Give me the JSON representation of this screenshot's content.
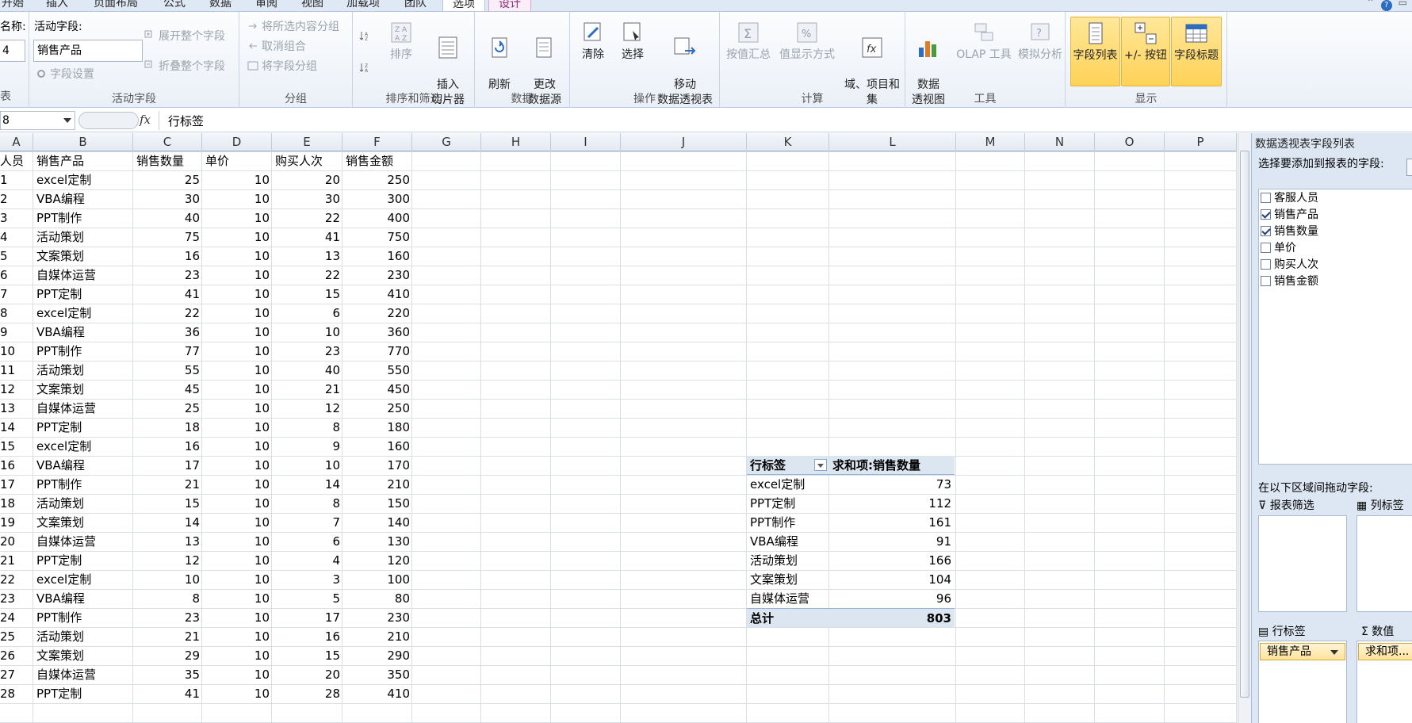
{
  "tabs": [
    "开始",
    "插入",
    "页面布局",
    "公式",
    "数据",
    "审阅",
    "视图",
    "加载项",
    "团队",
    "选项",
    "设计"
  ],
  "ribbon": {
    "pivot_name_label": "名称:",
    "pivot_name_value": "4",
    "active_field_label": "活动字段:",
    "active_field_value": "销售产品",
    "field_settings": "字段设置",
    "expand_field": "展开整个字段",
    "collapse_field": "折叠整个字段",
    "group_active": "活动字段",
    "group_selection": "将所选内容分组",
    "ungroup": "取消组合",
    "group_field": "将字段分组",
    "group_group": "分组",
    "sort": "排序",
    "insert_slicer": "插入\n切片器",
    "group_sortfilter": "排序和筛选",
    "refresh": "刷新",
    "change_source": "更改\n数据源",
    "group_data": "数据",
    "clear": "清除",
    "select": "选择",
    "move_pivot": "移动\n数据透视表",
    "group_actions": "操作",
    "summarize": "按值汇总",
    "show_values": "值显示方式",
    "fields_items": "域、项目和\n集",
    "group_calc": "计算",
    "pivot_chart": "数据\n透视图",
    "olap": "OLAP 工具",
    "whatif": "模拟分析",
    "group_tools": "工具",
    "field_list": "字段列表",
    "buttons": "+/- 按钮",
    "field_headers": "字段标题",
    "group_show": "显示",
    "table_label": "表"
  },
  "formula_bar": {
    "name_box": "8",
    "value": "行标签"
  },
  "columns": [
    "A",
    "B",
    "C",
    "D",
    "E",
    "F",
    "G",
    "H",
    "I",
    "J",
    "K",
    "L",
    "M",
    "N",
    "O",
    "P"
  ],
  "header_row": [
    "人员",
    "销售产品",
    "销售数量",
    "单价",
    "购买人次",
    "销售金额"
  ],
  "rows": [
    [
      "1",
      "excel定制",
      "25",
      "10",
      "20",
      "250"
    ],
    [
      "2",
      "VBA编程",
      "30",
      "10",
      "30",
      "300"
    ],
    [
      "3",
      "PPT制作",
      "40",
      "10",
      "22",
      "400"
    ],
    [
      "4",
      "活动策划",
      "75",
      "10",
      "41",
      "750"
    ],
    [
      "5",
      "文案策划",
      "16",
      "10",
      "13",
      "160"
    ],
    [
      "6",
      "自媒体运营",
      "23",
      "10",
      "22",
      "230"
    ],
    [
      "7",
      "PPT定制",
      "41",
      "10",
      "15",
      "410"
    ],
    [
      "8",
      "excel定制",
      "22",
      "10",
      "6",
      "220"
    ],
    [
      "9",
      "VBA编程",
      "36",
      "10",
      "10",
      "360"
    ],
    [
      "10",
      "PPT制作",
      "77",
      "10",
      "23",
      "770"
    ],
    [
      "11",
      "活动策划",
      "55",
      "10",
      "40",
      "550"
    ],
    [
      "12",
      "文案策划",
      "45",
      "10",
      "21",
      "450"
    ],
    [
      "13",
      "自媒体运营",
      "25",
      "10",
      "12",
      "250"
    ],
    [
      "14",
      "PPT定制",
      "18",
      "10",
      "8",
      "180"
    ],
    [
      "15",
      "excel定制",
      "16",
      "10",
      "9",
      "160"
    ],
    [
      "16",
      "VBA编程",
      "17",
      "10",
      "10",
      "170"
    ],
    [
      "17",
      "PPT制作",
      "21",
      "10",
      "14",
      "210"
    ],
    [
      "18",
      "活动策划",
      "15",
      "10",
      "8",
      "150"
    ],
    [
      "19",
      "文案策划",
      "14",
      "10",
      "7",
      "140"
    ],
    [
      "20",
      "自媒体运营",
      "13",
      "10",
      "6",
      "130"
    ],
    [
      "21",
      "PPT定制",
      "12",
      "10",
      "4",
      "120"
    ],
    [
      "22",
      "excel定制",
      "10",
      "10",
      "3",
      "100"
    ],
    [
      "23",
      "VBA编程",
      "8",
      "10",
      "5",
      "80"
    ],
    [
      "24",
      "PPT制作",
      "23",
      "10",
      "17",
      "230"
    ],
    [
      "25",
      "活动策划",
      "21",
      "10",
      "16",
      "210"
    ],
    [
      "26",
      "文案策划",
      "29",
      "10",
      "15",
      "290"
    ],
    [
      "27",
      "自媒体运营",
      "35",
      "10",
      "20",
      "350"
    ],
    [
      "28",
      "PPT定制",
      "41",
      "10",
      "28",
      "410"
    ]
  ],
  "pivot": {
    "row_label": "行标签",
    "value_label": "求和项:销售数量",
    "items": [
      {
        "label": "excel定制",
        "value": "73"
      },
      {
        "label": "PPT定制",
        "value": "112"
      },
      {
        "label": "PPT制作",
        "value": "161"
      },
      {
        "label": "VBA编程",
        "value": "91"
      },
      {
        "label": "活动策划",
        "value": "166"
      },
      {
        "label": "文案策划",
        "value": "104"
      },
      {
        "label": "自媒体运营",
        "value": "96"
      }
    ],
    "total_label": "总计",
    "total_value": "803"
  },
  "field_pane": {
    "title": "数据透视表字段列表",
    "prompt": "选择要添加到报表的字段:",
    "fields": [
      {
        "name": "客服人员",
        "checked": false
      },
      {
        "name": "销售产品",
        "checked": true
      },
      {
        "name": "销售数量",
        "checked": true
      },
      {
        "name": "单价",
        "checked": false
      },
      {
        "name": "购买人次",
        "checked": false
      },
      {
        "name": "销售金额",
        "checked": false
      }
    ],
    "drag_prompt": "在以下区域间拖动字段:",
    "report_filter": "报表筛选",
    "column_labels": "列标签",
    "row_labels": "行标签",
    "values": "数值",
    "row_chip": "销售产品",
    "value_chip": "求和项..."
  }
}
